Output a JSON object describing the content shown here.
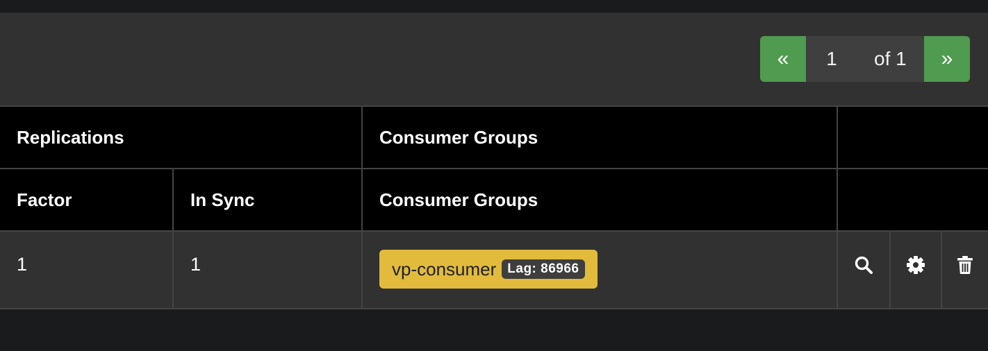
{
  "pagination": {
    "prev_label": "«",
    "current_page": "1",
    "of_label": "of 1",
    "next_label": "»"
  },
  "table": {
    "group_headers": {
      "replications": "Replications",
      "consumer_groups": "Consumer Groups"
    },
    "column_headers": {
      "factor": "Factor",
      "in_sync": "In Sync",
      "consumer_groups": "Consumer Groups"
    },
    "rows": [
      {
        "factor": "1",
        "in_sync": "1",
        "consumer_group": {
          "name": "vp-consumer",
          "lag": "Lag: 86966"
        },
        "actions": [
          "search-icon",
          "gear-icon",
          "trash-icon"
        ]
      }
    ]
  },
  "colors": {
    "pager_green": "#4f9b4f",
    "tag_yellow": "#e2bb3d",
    "header_black": "#000000",
    "toolbar_gray": "#313131"
  }
}
